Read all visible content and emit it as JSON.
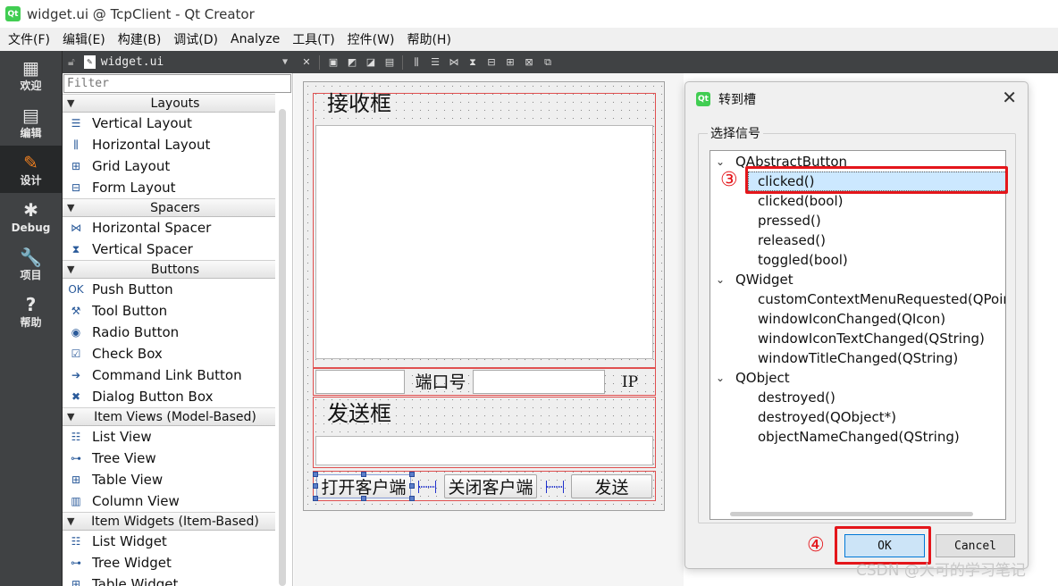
{
  "window": {
    "title": "widget.ui @ TcpClient - Qt Creator",
    "logo": "Qt"
  },
  "menu": [
    "文件(F)",
    "编辑(E)",
    "构建(B)",
    "调试(D)",
    "Analyze",
    "工具(T)",
    "控件(W)",
    "帮助(H)"
  ],
  "modes": [
    {
      "label": "欢迎",
      "icon": "▦"
    },
    {
      "label": "编辑",
      "icon": "▤"
    },
    {
      "label": "设计",
      "icon": "✎"
    },
    {
      "label": "Debug",
      "icon": "✱"
    },
    {
      "label": "项目",
      "icon": "🔧"
    },
    {
      "label": "帮助",
      "icon": "?"
    }
  ],
  "doc": {
    "filename": "widget.ui"
  },
  "widgetbox": {
    "filter_placeholder": "Filter",
    "sections": [
      {
        "title": "Layouts",
        "items": [
          {
            "label": "Vertical Layout",
            "icon": "☰"
          },
          {
            "label": "Horizontal Layout",
            "icon": "⫼"
          },
          {
            "label": "Grid Layout",
            "icon": "⊞"
          },
          {
            "label": "Form Layout",
            "icon": "⊟"
          }
        ]
      },
      {
        "title": "Spacers",
        "items": [
          {
            "label": "Horizontal Spacer",
            "icon": "⋈"
          },
          {
            "label": "Vertical Spacer",
            "icon": "⧗"
          }
        ]
      },
      {
        "title": "Buttons",
        "items": [
          {
            "label": "Push Button",
            "icon": "OK"
          },
          {
            "label": "Tool Button",
            "icon": "⚒"
          },
          {
            "label": "Radio Button",
            "icon": "◉"
          },
          {
            "label": "Check Box",
            "icon": "☑"
          },
          {
            "label": "Command Link Button",
            "icon": "➔"
          },
          {
            "label": "Dialog Button Box",
            "icon": "✖"
          }
        ]
      },
      {
        "title": "Item Views (Model-Based)",
        "items": [
          {
            "label": "List View",
            "icon": "☷"
          },
          {
            "label": "Tree View",
            "icon": "⊶"
          },
          {
            "label": "Table View",
            "icon": "⊞"
          },
          {
            "label": "Column View",
            "icon": "▥"
          }
        ]
      },
      {
        "title": "Item Widgets (Item-Based)",
        "items": [
          {
            "label": "List Widget",
            "icon": "☷"
          },
          {
            "label": "Tree Widget",
            "icon": "⊶"
          },
          {
            "label": "Table Widget",
            "icon": "⊞"
          }
        ]
      }
    ]
  },
  "form": {
    "receive_label": "接收框",
    "port_label": "端口号",
    "ip_label": "IP",
    "send_label": "发送框",
    "open_button": "打开客户端",
    "close_button": "关闭客户端",
    "send_button": "发送"
  },
  "dialog": {
    "title": "转到槽",
    "group_title": "选择信号",
    "tree": [
      {
        "text": "QAbstractButton",
        "level": 0,
        "expanded": true
      },
      {
        "text": "clicked()",
        "level": 1,
        "selected": true
      },
      {
        "text": "clicked(bool)",
        "level": 1
      },
      {
        "text": "pressed()",
        "level": 1
      },
      {
        "text": "released()",
        "level": 1
      },
      {
        "text": "toggled(bool)",
        "level": 1
      },
      {
        "text": "QWidget",
        "level": 0,
        "expanded": true
      },
      {
        "text": "customContextMenuRequested(QPoint)",
        "level": 1
      },
      {
        "text": "windowIconChanged(QIcon)",
        "level": 1
      },
      {
        "text": "windowIconTextChanged(QString)",
        "level": 1
      },
      {
        "text": "windowTitleChanged(QString)",
        "level": 1
      },
      {
        "text": "QObject",
        "level": 0,
        "expanded": true
      },
      {
        "text": "destroyed()",
        "level": 1
      },
      {
        "text": "destroyed(QObject*)",
        "level": 1
      },
      {
        "text": "objectNameChanged(QString)",
        "level": 1
      }
    ],
    "ok_label": "OK",
    "cancel_label": "Cancel"
  },
  "annotations": {
    "step3": "③",
    "step4": "④",
    "color": "#e4161b"
  },
  "watermark": "CSDN @大可的学习笔记"
}
